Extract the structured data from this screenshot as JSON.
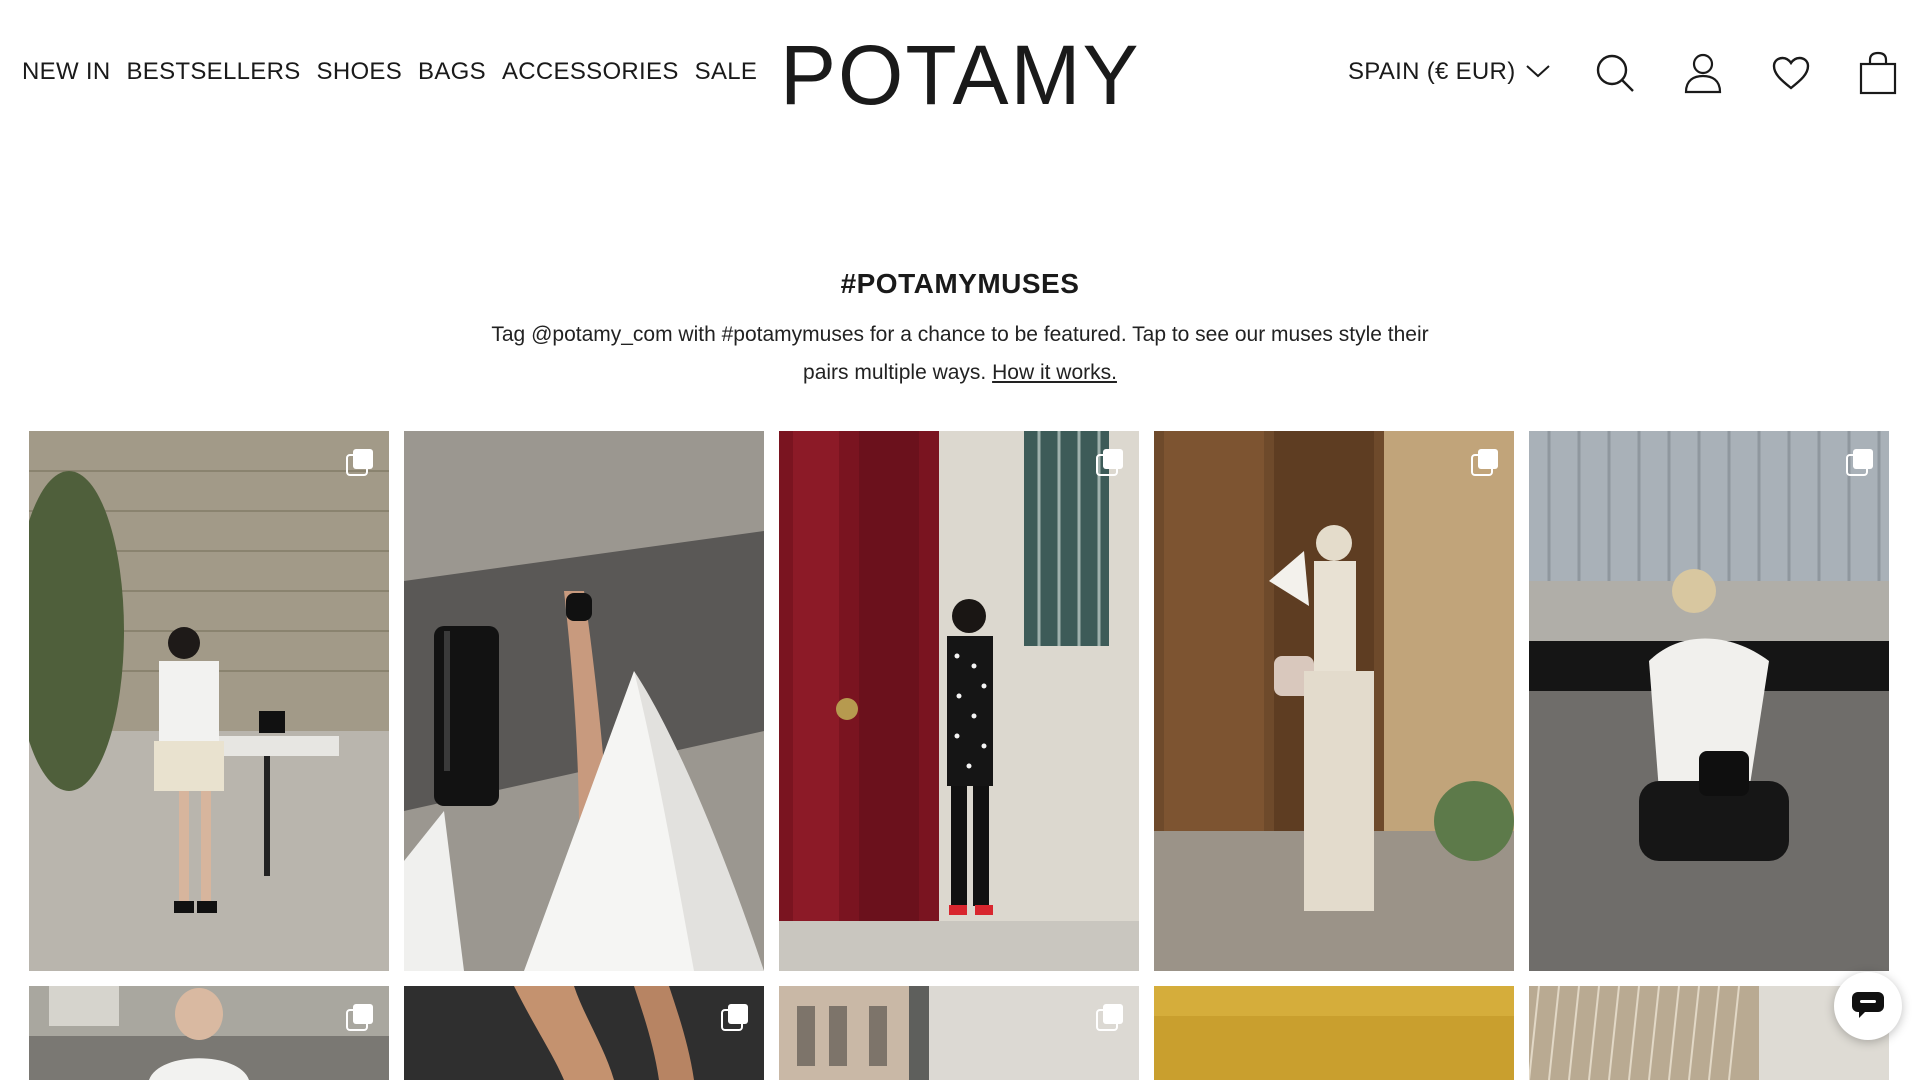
{
  "nav": {
    "items": [
      {
        "label": "NEW IN"
      },
      {
        "label": "BESTSELLERS"
      },
      {
        "label": "SHOES"
      },
      {
        "label": "BAGS"
      },
      {
        "label": "ACCESSORIES"
      },
      {
        "label": "SALE"
      }
    ]
  },
  "brand": {
    "logo": "POTAMY"
  },
  "region": {
    "label": "SPAIN (€ EUR)",
    "icon": "chevron-down-icon"
  },
  "header_icons": [
    "search-icon",
    "account-icon",
    "wishlist-heart-icon",
    "shopping-bag-icon"
  ],
  "muses": {
    "title": "#POTAMYMUSES",
    "description": "Tag @potamy_com with #potamymuses for a chance to be featured. Tap to see our muses style their pairs multiple ways.",
    "link": "How it works."
  },
  "gallery": {
    "multi_image_icon": "multiple-images-icon",
    "row1": [
      {
        "label": "muse-cafe-white-shirt"
      },
      {
        "label": "muse-sandal-overhead"
      },
      {
        "label": "muse-red-door-polka"
      },
      {
        "label": "muse-wooden-door-fan"
      },
      {
        "label": "muse-white-top-crouch"
      }
    ],
    "row2": [
      {
        "label": "muse-street-portrait"
      },
      {
        "label": "muse-legs-closeup"
      },
      {
        "label": "muse-building-facade"
      },
      {
        "label": "muse-yellow-wall"
      },
      {
        "label": "muse-sequin-detail"
      }
    ]
  },
  "chat": {
    "icon": "chat-bubble-icon"
  },
  "colors": {
    "text": "#1a1a1a",
    "background": "#ffffff",
    "door_red": "#7a1420"
  }
}
